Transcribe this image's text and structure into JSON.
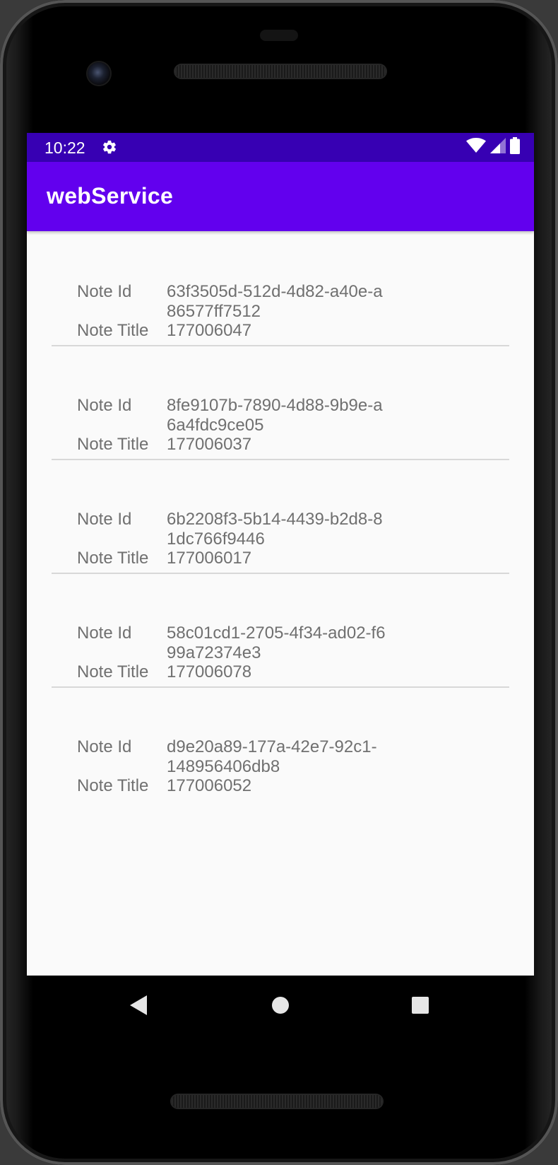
{
  "status_bar": {
    "time": "10:22",
    "icons": [
      "gear-icon",
      "wifi-icon",
      "cell-signal-icon",
      "battery-icon"
    ]
  },
  "app_bar": {
    "title": "webService"
  },
  "notes": [
    {
      "id_label": "Note Id",
      "id_value": "63f3505d-512d-4d82-a40e-a86577ff7512",
      "title_label": "Note Title",
      "title_value": "177006047"
    },
    {
      "id_label": "Note Id",
      "id_value": "8fe9107b-7890-4d88-9b9e-a6a4fdc9ce05",
      "title_label": "Note Title",
      "title_value": "177006037"
    },
    {
      "id_label": "Note Id",
      "id_value": "6b2208f3-5b14-4439-b2d8-81dc766f9446",
      "title_label": "Note Title",
      "title_value": "177006017"
    },
    {
      "id_label": "Note Id",
      "id_value": "58c01cd1-2705-4f34-ad02-f699a72374e3",
      "title_label": "Note Title",
      "title_value": "177006078"
    },
    {
      "id_label": "Note Id",
      "id_value": "d9e20a89-177a-42e7-92c1-148956406db8",
      "title_label": "Note Title",
      "title_value": "177006052"
    }
  ],
  "nav_bar": {
    "icons": [
      "back-icon",
      "home-icon",
      "recents-icon"
    ]
  },
  "colors": {
    "status_bar": "#3700b3",
    "app_bar": "#6200ee",
    "background": "#fafafa",
    "text": "#707070",
    "divider": "#d8d8d8"
  }
}
